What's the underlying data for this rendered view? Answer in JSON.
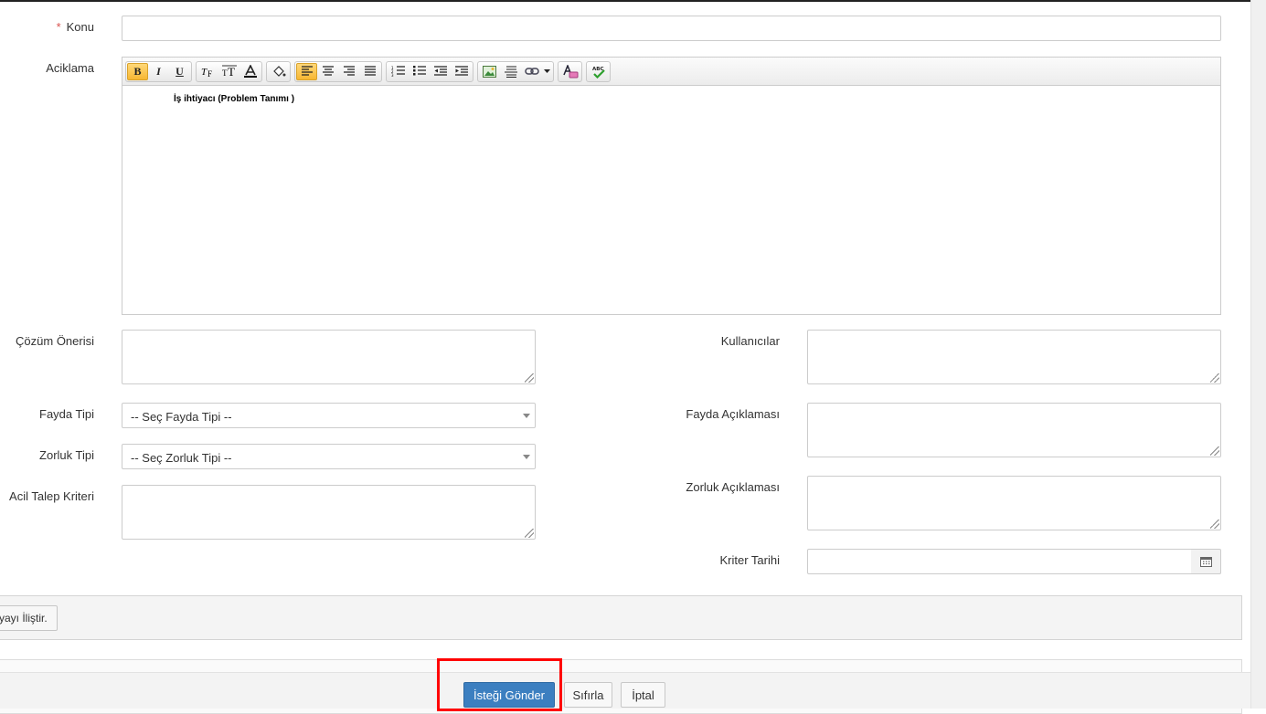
{
  "form": {
    "konu": {
      "label": "Konu",
      "required_mark": "*",
      "value": ""
    },
    "aciklama": {
      "label": "Aciklama",
      "content": "İş ihtiyacı (Problem Tanımı )"
    },
    "cozum": {
      "label": "Çözüm Önerisi",
      "value": ""
    },
    "kullanicilar": {
      "label": "Kullanıcılar",
      "value": ""
    },
    "fayda_tipi": {
      "label": "Fayda Tipi",
      "selected": "-- Seç Fayda Tipi --"
    },
    "fayda_aciklamasi": {
      "label": "Fayda Açıklaması",
      "value": ""
    },
    "zorluk_tipi": {
      "label": "Zorluk Tipi",
      "selected": "-- Seç Zorluk Tipi --"
    },
    "zorluk_aciklamasi": {
      "label": "Zorluk Açıklaması",
      "value": ""
    },
    "acil_talep": {
      "label": "Acil Talep Kriteri",
      "value": ""
    },
    "kriter_tarihi": {
      "label": "Kriter Tarihi",
      "value": ""
    }
  },
  "attach": {
    "label": "yayı İliştir."
  },
  "footer": {
    "submit_label": "İsteği Gönder",
    "reset_label": "Sıfırla",
    "cancel_label": "İptal"
  },
  "toolbar": {
    "bold": "B",
    "italic": "I",
    "underline": "U",
    "groups": [
      [
        "bold-icon",
        "italic-icon",
        "underline-icon"
      ],
      [
        "font-family-icon",
        "font-size-icon",
        "font-color-icon"
      ],
      [
        "paint-bucket-icon"
      ],
      [
        "align-left-icon",
        "align-center-icon",
        "align-right-icon",
        "align-justify-icon"
      ],
      [
        "ordered-list-icon",
        "unordered-list-icon",
        "outdent-icon",
        "indent-icon"
      ],
      [
        "image-icon",
        "horizontal-rule-icon",
        "link-icon",
        "dropdown-icon"
      ],
      [
        "format-text-icon"
      ],
      [
        "spellcheck-icon"
      ]
    ]
  },
  "colors": {
    "primary": "#3c7fc0",
    "highlight": "#ff0000",
    "required": "#d9534f",
    "active_tool": "#f7b733"
  }
}
